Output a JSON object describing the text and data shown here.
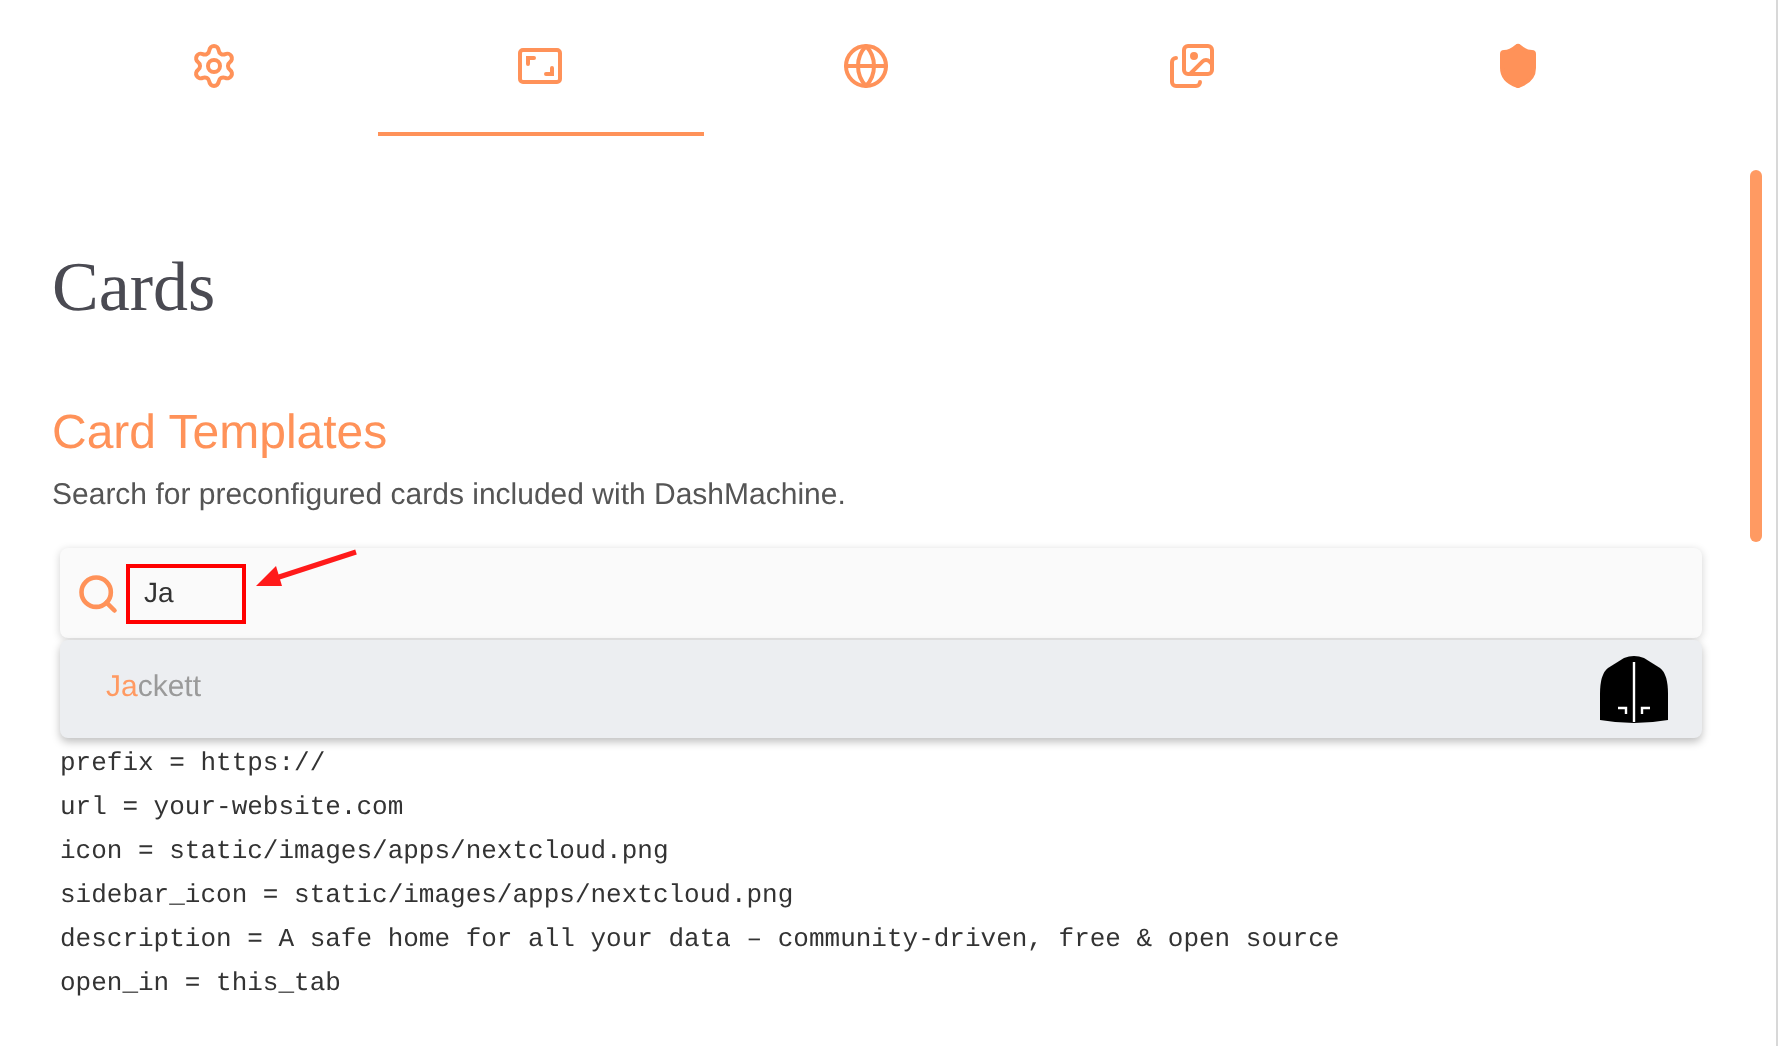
{
  "tabs": [
    {
      "kind": "gear",
      "selected": false
    },
    {
      "kind": "frame",
      "selected": true
    },
    {
      "kind": "globe",
      "selected": false
    },
    {
      "kind": "images",
      "selected": false
    },
    {
      "kind": "shield",
      "selected": false
    }
  ],
  "title": "Cards",
  "section": {
    "heading": "Card Templates",
    "description": "Search for preconfigured cards included with DashMachine."
  },
  "search": {
    "value": "Ja"
  },
  "suggestions": [
    {
      "match": "Ja",
      "rest": "ckett",
      "selected": true
    }
  ],
  "code_lines": [
    "prefix = https://",
    "url = your-website.com",
    "icon = static/images/apps/nextcloud.png",
    "sidebar_icon = static/images/apps/nextcloud.png",
    "description = A safe home for all your data – community-driven, free & open source",
    "open_in = this_tab"
  ]
}
